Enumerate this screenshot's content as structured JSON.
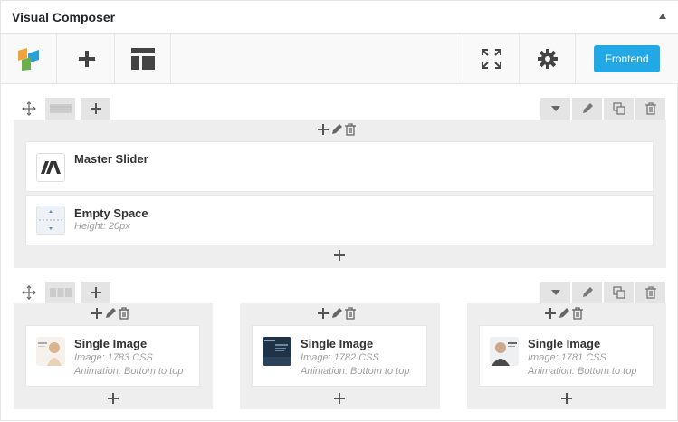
{
  "header": {
    "title": "Visual Composer"
  },
  "toolbar": {
    "frontend_label": "Frontend"
  },
  "row1": {
    "elements": [
      {
        "title": "Master Slider",
        "subtitle": ""
      },
      {
        "title": "Empty Space",
        "subtitle": "Height: 20px"
      }
    ]
  },
  "row2": {
    "columns": [
      {
        "title": "Single Image",
        "line1": "Image: 1783  CSS",
        "line2": "Animation: Bottom to top"
      },
      {
        "title": "Single Image",
        "line1": "Image: 1782  CSS",
        "line2": "Animation: Bottom to top"
      },
      {
        "title": "Single Image",
        "line1": "Image: 1781  CSS",
        "line2": "Animation: Bottom to top"
      }
    ]
  },
  "colors": {
    "accent": "#23a8e6",
    "row_bg": "#eeeeee",
    "ctrl_bg": "#e4e4e4"
  }
}
